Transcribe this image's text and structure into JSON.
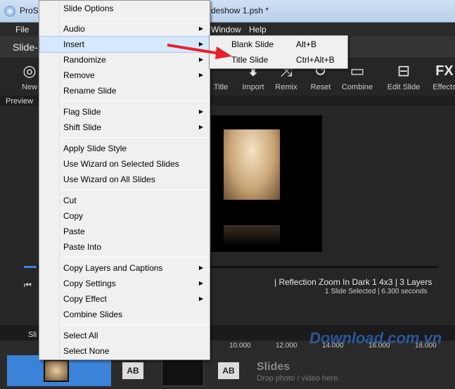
{
  "window": {
    "title_left": "ProS",
    "title_right": "deshow 1.psh *"
  },
  "menubar": {
    "items": [
      "File",
      "Window",
      "Help"
    ]
  },
  "tabbar": {
    "active_tab": "Slide-"
  },
  "toolbar": {
    "buttons": [
      {
        "label": "New",
        "icon": "new-slideshow-icon"
      },
      {
        "label": "Title",
        "icon": "title-icon"
      },
      {
        "label": "Import",
        "icon": "import-icon"
      },
      {
        "label": "Remix",
        "icon": "remix-icon"
      },
      {
        "label": "Reset",
        "icon": "reset-icon"
      },
      {
        "label": "Combine",
        "icon": "combine-icon"
      },
      {
        "label": "Edit Slide",
        "icon": "edit-slide-icon"
      },
      {
        "label": "Effects",
        "icon": "fx-icon"
      }
    ]
  },
  "preview": {
    "label": "Preview",
    "style_info": "|  Reflection Zoom In Dark 1 4x3  |  3 Layers",
    "selection_info": "1 Slide Selected  |  6.300 seconds",
    "progress": 0.03
  },
  "timeline": {
    "tab": "Sli",
    "ruler_ticks": [
      "10.000",
      "12.000",
      "14.000",
      "16.000",
      "18.000"
    ],
    "empty_title": "Slides",
    "empty_hint": "Drop photo / video here.",
    "watermark": "Download.com.vn"
  },
  "context_menu": {
    "items": [
      {
        "label": "Slide Options",
        "submenu": false
      },
      {
        "label": "Audio",
        "submenu": true
      },
      {
        "label": "Insert",
        "submenu": true,
        "highlighted": true
      },
      {
        "label": "Randomize",
        "submenu": true
      },
      {
        "label": "Remove",
        "submenu": true
      },
      {
        "label": "Rename Slide",
        "submenu": false
      },
      {
        "label": "Flag Slide",
        "submenu": true
      },
      {
        "label": "Shift Slide",
        "submenu": true
      },
      {
        "label": "Apply Slide Style",
        "submenu": false
      },
      {
        "label": "Use Wizard on Selected Slides",
        "submenu": false
      },
      {
        "label": "Use Wizard on All Slides",
        "submenu": false
      },
      {
        "label": "Cut",
        "submenu": false
      },
      {
        "label": "Copy",
        "submenu": false
      },
      {
        "label": "Paste",
        "submenu": false
      },
      {
        "label": "Paste Into",
        "submenu": false
      },
      {
        "label": "Copy Layers and Captions",
        "submenu": true
      },
      {
        "label": "Copy Settings",
        "submenu": true
      },
      {
        "label": "Copy Effect",
        "submenu": true
      },
      {
        "label": "Combine Slides",
        "submenu": false
      },
      {
        "label": "Select All",
        "submenu": false
      },
      {
        "label": "Select None",
        "submenu": false
      }
    ]
  },
  "insert_submenu": {
    "items": [
      {
        "label": "Blank Slide",
        "shortcut": "Alt+B"
      },
      {
        "label": "Title Slide",
        "shortcut": "Ctrl+Alt+B"
      }
    ]
  },
  "colors": {
    "accent": "#3b83d8",
    "arrow": "#e8202a",
    "menu_bg": "#f0f0f0"
  }
}
